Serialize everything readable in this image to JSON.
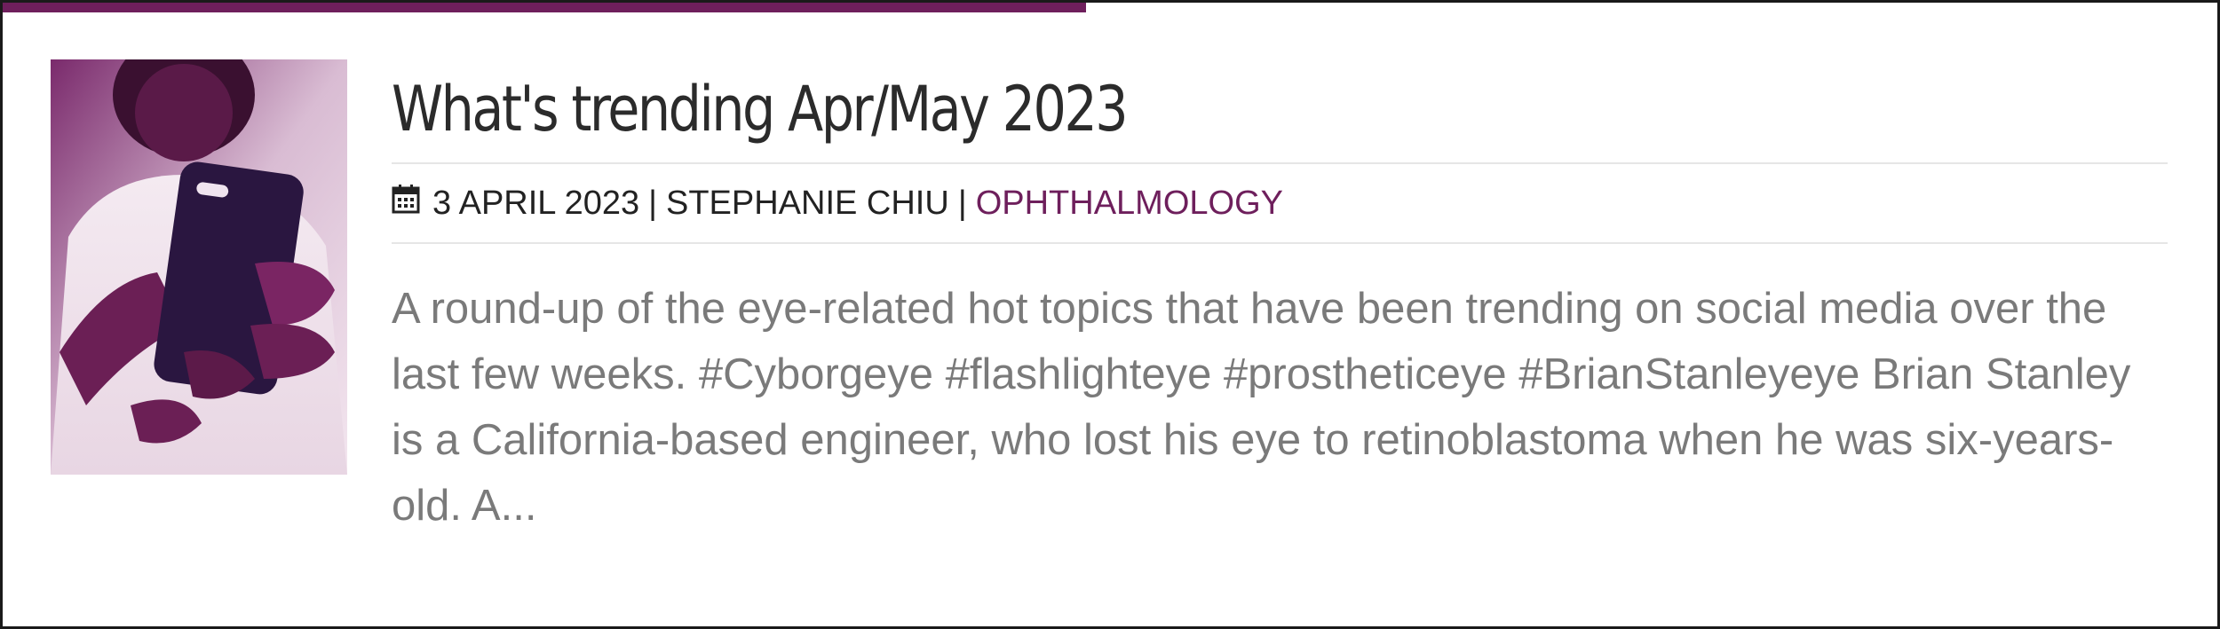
{
  "article": {
    "title": "What's trending Apr/May 2023",
    "date": "3 APRIL 2023",
    "author": "STEPHANIE CHIU",
    "separator": "|",
    "category": "OPHTHALMOLOGY",
    "excerpt": "A round-up of the eye-related hot topics that have been trending on social media over the last few weeks. #Cyborgeye #flashlighteye #prostheticeye #BrianStanleyeye Brian Stanley is a California-based engineer, who lost his eye to retinoblastoma when he was six-years-old. A...",
    "thumbnail_icon": "person-holding-phone-photo"
  },
  "colors": {
    "accent": "#6e1f5c",
    "title": "#2b2b2b",
    "meta": "#222222",
    "excerpt": "#7a7a7a",
    "divider": "#e6e6e6"
  }
}
